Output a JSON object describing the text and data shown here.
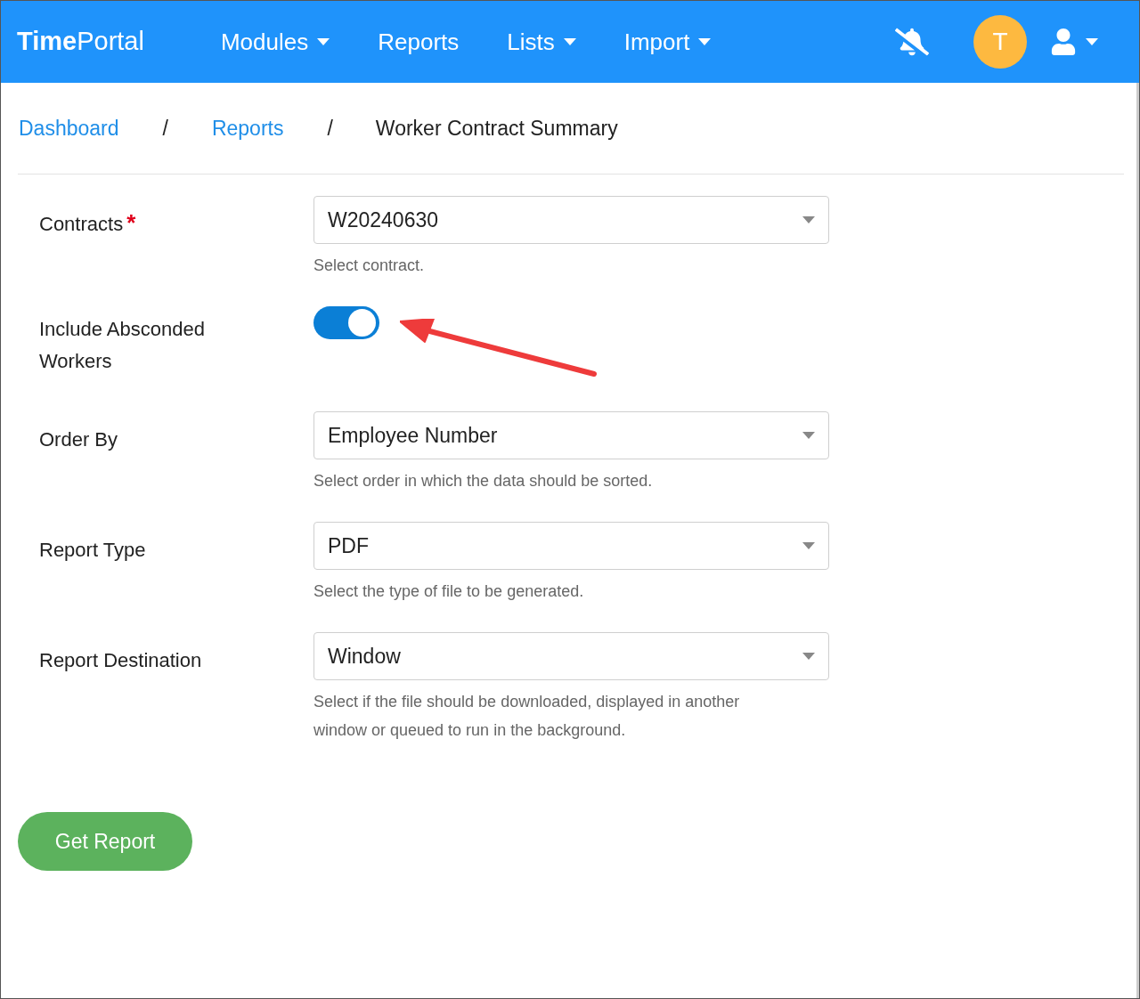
{
  "header": {
    "logo": {
      "bold": "Time",
      "regular": "Portal"
    },
    "nav": [
      {
        "label": "Modules",
        "dropdown": true
      },
      {
        "label": "Reports",
        "dropdown": false
      },
      {
        "label": "Lists",
        "dropdown": true
      },
      {
        "label": "Import",
        "dropdown": true
      }
    ],
    "avatar": "T"
  },
  "breadcrumb": [
    {
      "kind": "link",
      "label": "Dashboard"
    },
    {
      "kind": "separator",
      "label": "/"
    },
    {
      "kind": "link",
      "label": "Reports"
    },
    {
      "kind": "separator",
      "label": "/"
    },
    {
      "kind": "current",
      "label": "Worker Contract Summary"
    }
  ],
  "form": {
    "fields": [
      {
        "kind": "select",
        "label": "Contracts",
        "required_mark": "*",
        "value": "W20240630",
        "help": "Select contract."
      },
      {
        "kind": "toggle",
        "label": "Include Absconded Workers",
        "on": true
      },
      {
        "kind": "select",
        "label": "Order By",
        "value": "Employee Number",
        "help": "Select order in which the data should be sorted."
      },
      {
        "kind": "select",
        "label": "Report Type",
        "value": "PDF",
        "help": "Select the type of file to be generated."
      },
      {
        "kind": "select",
        "label": "Report Destination",
        "value": "Window",
        "help": "Select if the file should be downloaded, displayed in another window or queued to run in the background."
      }
    ]
  },
  "submit": {
    "label": "Get Report"
  }
}
